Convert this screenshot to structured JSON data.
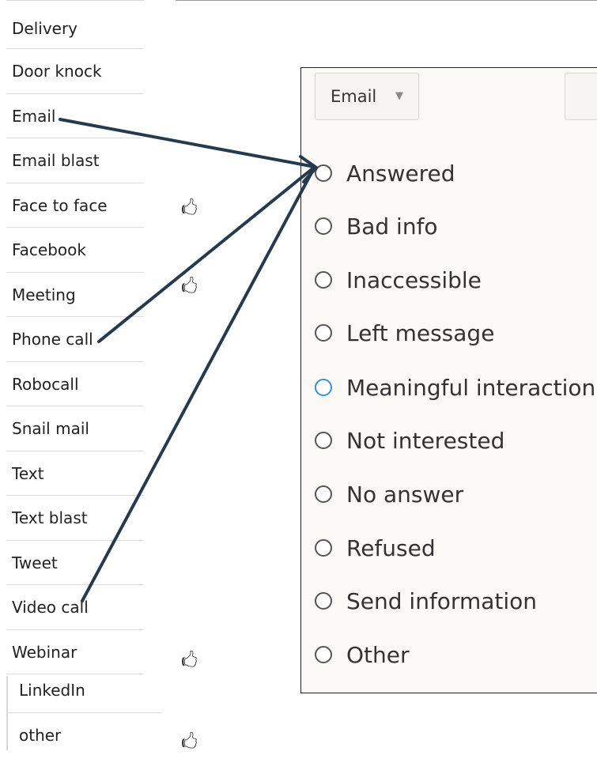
{
  "contact_types": [
    "Delivery",
    "Door knock",
    "Email",
    "Email blast",
    "Face to face",
    "Facebook",
    "Meeting",
    "Phone call",
    "Robocall",
    "Snail mail",
    "Text",
    "Text blast",
    "Tweet",
    "Video call",
    "Webinar"
  ],
  "extra_types": [
    "LinkedIn",
    "other"
  ],
  "thumb_glyph": "🖒",
  "panel": {
    "selected_type": "Email",
    "caret": "▼",
    "results": [
      "Answered",
      "Bad info",
      "Inaccessible",
      "Left message",
      "Meaningful interaction",
      "Not interested",
      "No answer",
      "Refused",
      "Send information",
      "Other"
    ],
    "focused_result": "Meaningful interaction"
  },
  "colors": {
    "arrow": "#253b4d",
    "radio_focus": "#3b8ed8",
    "panel_bg": "#faf9f6"
  },
  "arrows_from": [
    "Email",
    "Phone call",
    "Video call"
  ],
  "arrows_to": "Answered"
}
